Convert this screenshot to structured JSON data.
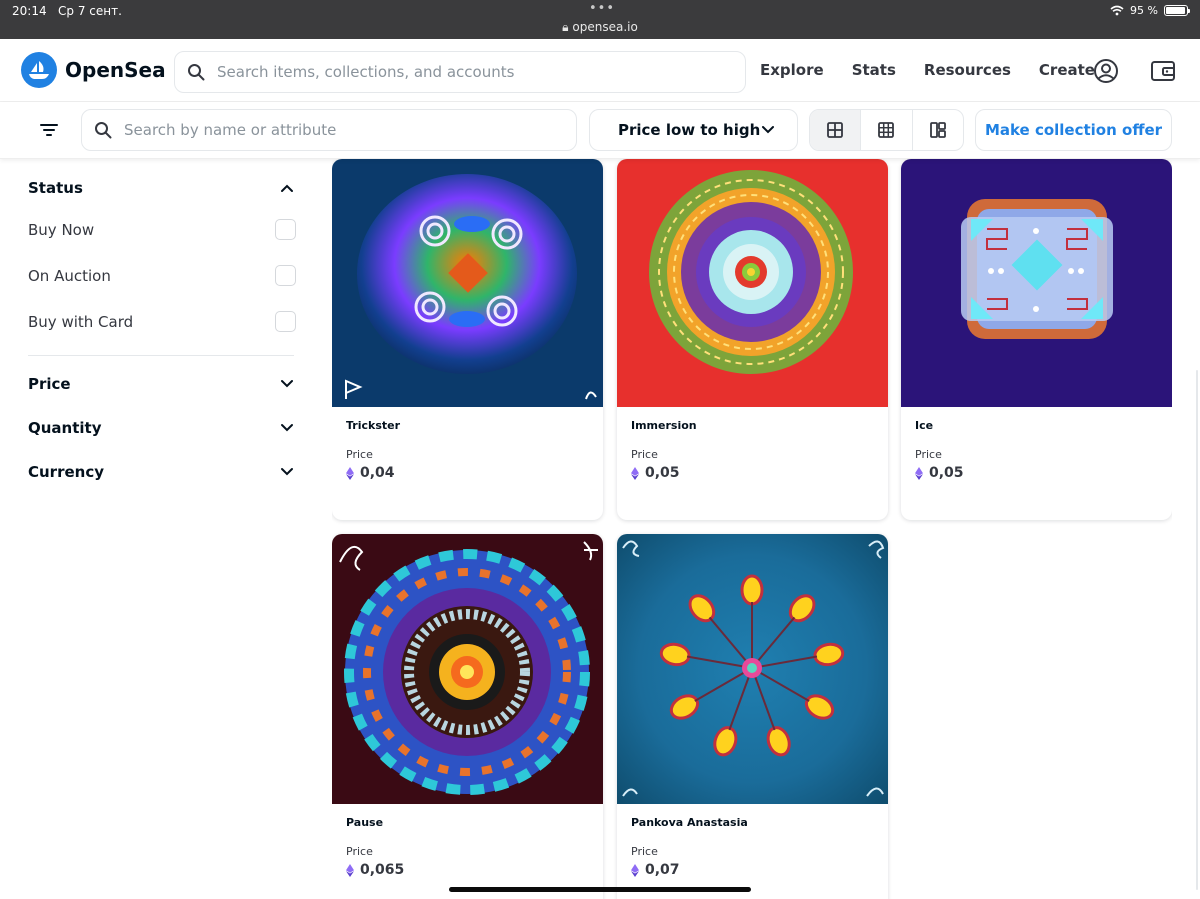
{
  "status_bar": {
    "time": "20:14",
    "date": "Ср 7 сент.",
    "url": "opensea.io",
    "battery": "95 %",
    "battery_level": 0.95
  },
  "header": {
    "brand": "OpenSea",
    "search_placeholder": "Search items, collections, and accounts",
    "nav": [
      "Explore",
      "Stats",
      "Resources",
      "Create"
    ],
    "icons": [
      "profile-icon",
      "wallet-icon"
    ]
  },
  "toolbar": {
    "filter_search_placeholder": "Search by name or attribute",
    "sort_value": "Price low to high",
    "offer_label": "Make collection offer"
  },
  "sidebar": {
    "status_title": "Status",
    "status_options": [
      "Buy Now",
      "On Auction",
      "Buy with Card"
    ],
    "sections": [
      "Price",
      "Quantity",
      "Currency"
    ]
  },
  "items": [
    {
      "name": "Trickster",
      "price_label": "Price",
      "price": "0,04"
    },
    {
      "name": "Immersion",
      "price_label": "Price",
      "price": "0,05"
    },
    {
      "name": "Ice",
      "price_label": "Price",
      "price": "0,05"
    },
    {
      "name": "Pause",
      "price_label": "Price",
      "price": "0,065"
    },
    {
      "name": "Pankova Anastasia",
      "price_label": "Price",
      "price": "0,07"
    }
  ],
  "colors": {
    "brand_blue": "#2081e2",
    "text_dark": "#04111d",
    "border": "#e5e8eb"
  }
}
